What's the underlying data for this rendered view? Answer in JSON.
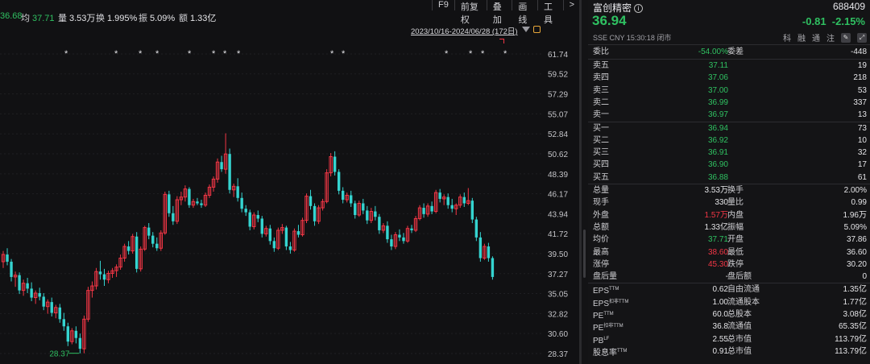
{
  "topbar": {
    "stats": [
      {
        "key": "",
        "value": "36.68",
        "color": "green"
      },
      {
        "key": "均",
        "value": "37.71",
        "color": "green"
      },
      {
        "key": "量",
        "value": "3.53万",
        "color": "white"
      },
      {
        "key": "换",
        "value": "1.995%",
        "color": "white"
      },
      {
        "key": "振",
        "value": "5.09%",
        "color": "white"
      },
      {
        "key": "额",
        "value": "1.33亿",
        "color": "white"
      }
    ],
    "toolbar": [
      "F9",
      "前复权",
      "叠加",
      "画线",
      "工具",
      ">"
    ],
    "range": "2023/10/16-2024/06/28 (172日)"
  },
  "chart_data": {
    "type": "candlestick",
    "y_ticks": [
      "61.74",
      "59.52",
      "57.29",
      "55.07",
      "52.84",
      "50.62",
      "48.39",
      "46.17",
      "43.94",
      "41.72",
      "39.50",
      "37.27",
      "35.05",
      "32.82",
      "30.60",
      "28.37"
    ],
    "ylim": [
      28.37,
      61.74
    ],
    "low_annotation": "28.37",
    "up_color": "#f23645",
    "down_color": "#35d4d0",
    "star_marker": "*",
    "star_groups": [
      1,
      1,
      1,
      2,
      1,
      2,
      1,
      2,
      1,
      1,
      1,
      2,
      1
    ],
    "candles": [
      [
        38.6,
        39.8,
        37.9,
        39.4
      ],
      [
        39.4,
        40.1,
        38.2,
        38.6
      ],
      [
        38.6,
        38.9,
        36.4,
        36.9
      ],
      [
        36.9,
        37.5,
        35.8,
        37.1
      ],
      [
        37.1,
        37.4,
        35.0,
        35.4
      ],
      [
        35.4,
        36.6,
        34.8,
        36.2
      ],
      [
        36.2,
        36.8,
        35.1,
        35.6
      ],
      [
        35.6,
        36.3,
        34.2,
        34.6
      ],
      [
        34.6,
        35.4,
        33.9,
        35.1
      ],
      [
        35.1,
        35.7,
        34.3,
        34.7
      ],
      [
        34.7,
        35.1,
        33.2,
        33.6
      ],
      [
        33.6,
        34.4,
        32.8,
        34.1
      ],
      [
        34.1,
        34.6,
        32.5,
        32.9
      ],
      [
        32.9,
        33.8,
        32.3,
        33.5
      ],
      [
        33.5,
        33.9,
        31.8,
        32.2
      ],
      [
        32.2,
        32.9,
        30.9,
        31.4
      ],
      [
        31.4,
        31.8,
        29.2,
        29.7
      ],
      [
        29.7,
        31.2,
        29.4,
        30.9
      ],
      [
        30.9,
        31.4,
        29.5,
        30.1
      ],
      [
        30.1,
        30.6,
        28.4,
        28.9
      ],
      [
        28.9,
        32.6,
        28.4,
        32.2
      ],
      [
        32.2,
        35.8,
        31.9,
        35.4
      ],
      [
        35.4,
        36.4,
        34.6,
        35.9
      ],
      [
        35.9,
        37.9,
        35.5,
        37.5
      ],
      [
        37.5,
        38.7,
        36.6,
        37.2
      ],
      [
        37.2,
        37.8,
        35.9,
        36.6
      ],
      [
        36.6,
        37.6,
        36.2,
        37.3
      ],
      [
        37.3,
        37.9,
        36.8,
        37.6
      ],
      [
        37.6,
        38.3,
        36.9,
        38.0
      ],
      [
        38.0,
        39.4,
        37.7,
        39.0
      ],
      [
        39.0,
        40.6,
        38.6,
        40.3
      ],
      [
        40.3,
        40.9,
        39.4,
        39.8
      ],
      [
        39.8,
        41.7,
        39.5,
        41.4
      ],
      [
        41.4,
        41.9,
        37.4,
        37.8
      ],
      [
        37.8,
        40.3,
        37.5,
        40.0
      ],
      [
        40.0,
        42.6,
        39.8,
        42.4
      ],
      [
        42.4,
        42.9,
        41.1,
        41.5
      ],
      [
        41.5,
        41.9,
        40.2,
        40.6
      ],
      [
        40.6,
        41.3,
        39.8,
        40.1
      ],
      [
        40.1,
        42.1,
        39.8,
        41.8
      ],
      [
        41.8,
        46.4,
        41.6,
        46.1
      ],
      [
        46.1,
        46.5,
        43.6,
        44.0
      ],
      [
        44.0,
        44.8,
        42.7,
        43.1
      ],
      [
        43.1,
        45.9,
        42.8,
        45.5
      ],
      [
        45.5,
        46.4,
        44.9,
        45.8
      ],
      [
        45.8,
        47.1,
        45.3,
        46.7
      ],
      [
        46.7,
        46.9,
        44.6,
        44.9
      ],
      [
        44.9,
        45.6,
        44.6,
        45.3
      ],
      [
        45.3,
        45.7,
        44.9,
        45.1
      ],
      [
        45.1,
        45.5,
        44.6,
        44.9
      ],
      [
        44.9,
        46.3,
        44.7,
        46.0
      ],
      [
        46.0,
        47.2,
        45.7,
        46.9
      ],
      [
        46.9,
        48.1,
        46.4,
        47.8
      ],
      [
        47.8,
        50.1,
        47.4,
        49.7
      ],
      [
        49.7,
        50.4,
        48.6,
        48.9
      ],
      [
        48.9,
        52.9,
        48.4,
        50.6
      ],
      [
        50.6,
        51.2,
        46.2,
        46.6
      ],
      [
        46.6,
        47.3,
        45.8,
        47.0
      ],
      [
        47.0,
        47.9,
        45.3,
        45.7
      ],
      [
        45.7,
        46.3,
        44.1,
        44.5
      ],
      [
        44.5,
        44.9,
        43.7,
        44.1
      ],
      [
        44.1,
        44.4,
        42.1,
        42.5
      ],
      [
        42.5,
        44.1,
        42.2,
        43.8
      ],
      [
        43.8,
        44.3,
        43.0,
        43.4
      ],
      [
        43.4,
        43.7,
        41.3,
        41.7
      ],
      [
        41.7,
        42.6,
        41.4,
        42.3
      ],
      [
        42.3,
        42.7,
        40.5,
        40.9
      ],
      [
        40.9,
        41.3,
        39.7,
        40.1
      ],
      [
        40.1,
        42.4,
        39.9,
        42.1
      ],
      [
        42.1,
        42.8,
        41.7,
        42.4
      ],
      [
        42.4,
        42.6,
        39.9,
        40.3
      ],
      [
        40.3,
        40.8,
        39.5,
        39.9
      ],
      [
        39.9,
        42.3,
        39.7,
        42.0
      ],
      [
        42.0,
        42.7,
        41.3,
        41.6
      ],
      [
        41.6,
        43.5,
        41.4,
        43.2
      ],
      [
        43.2,
        46.2,
        42.9,
        45.9
      ],
      [
        45.9,
        46.6,
        44.4,
        44.8
      ],
      [
        44.8,
        45.1,
        42.6,
        43.1
      ],
      [
        43.1,
        44.9,
        42.8,
        44.6
      ],
      [
        44.6,
        45.6,
        44.3,
        45.3
      ],
      [
        45.3,
        48.9,
        45.1,
        48.5
      ],
      [
        48.5,
        50.7,
        48.1,
        50.3
      ],
      [
        50.3,
        50.9,
        48.2,
        48.6
      ],
      [
        48.6,
        48.9,
        46.1,
        46.5
      ],
      [
        46.5,
        46.9,
        45.1,
        45.5
      ],
      [
        45.5,
        46.3,
        45.2,
        46.0
      ],
      [
        46.0,
        46.5,
        44.7,
        45.1
      ],
      [
        45.1,
        45.4,
        43.4,
        43.8
      ],
      [
        43.8,
        45.4,
        43.6,
        45.1
      ],
      [
        45.1,
        45.6,
        43.9,
        44.3
      ],
      [
        44.3,
        44.8,
        42.8,
        43.2
      ],
      [
        43.2,
        44.6,
        42.9,
        44.2
      ],
      [
        44.2,
        44.8,
        43.2,
        43.6
      ],
      [
        43.6,
        43.9,
        41.7,
        42.1
      ],
      [
        42.1,
        42.9,
        41.8,
        42.6
      ],
      [
        42.6,
        43.1,
        40.7,
        41.1
      ],
      [
        41.1,
        41.6,
        39.9,
        40.3
      ],
      [
        40.3,
        41.9,
        40.0,
        41.6
      ],
      [
        41.6,
        42.2,
        40.9,
        41.3
      ],
      [
        41.3,
        41.8,
        40.6,
        40.9
      ],
      [
        40.9,
        42.6,
        40.7,
        42.3
      ],
      [
        42.3,
        42.7,
        41.8,
        42.1
      ],
      [
        42.1,
        43.7,
        41.9,
        43.4
      ],
      [
        43.4,
        44.9,
        43.2,
        44.6
      ],
      [
        44.6,
        45.1,
        43.5,
        43.9
      ],
      [
        43.9,
        45.1,
        43.6,
        44.8
      ],
      [
        44.8,
        45.3,
        43.9,
        44.2
      ],
      [
        44.2,
        46.6,
        44.0,
        46.3
      ],
      [
        46.3,
        46.7,
        45.2,
        45.6
      ],
      [
        45.6,
        46.1,
        44.9,
        45.8
      ],
      [
        45.8,
        46.2,
        44.5,
        44.9
      ],
      [
        44.9,
        45.6,
        44.1,
        44.5
      ],
      [
        44.5,
        45.1,
        43.8,
        44.9
      ],
      [
        44.9,
        46.1,
        44.6,
        45.8
      ],
      [
        45.8,
        46.3,
        44.7,
        45.1
      ],
      [
        45.1,
        46.8,
        44.9,
        45.4
      ],
      [
        45.4,
        45.7,
        42.9,
        43.3
      ],
      [
        43.3,
        43.6,
        40.9,
        41.3
      ],
      [
        41.3,
        41.9,
        38.6,
        39.0
      ],
      [
        39.0,
        40.6,
        38.8,
        40.3
      ],
      [
        40.3,
        40.7,
        38.6,
        39.0
      ],
      [
        39.0,
        39.2,
        36.6,
        36.9
      ]
    ]
  },
  "quote": {
    "name": "富创精密",
    "info_icon": "i",
    "code": "688409",
    "price": "36.94",
    "change": "-0.81",
    "change_pct": "-2.15%",
    "meta": "SSE  CNY  15:30:18  闭市",
    "tags": [
      "科",
      "融",
      "通",
      "注"
    ],
    "tag_icons": [
      "✎",
      "⤢"
    ],
    "weibi": {
      "label": "委比",
      "value": "-54.00%",
      "label2": "委差",
      "value2": "-448"
    },
    "asks": [
      {
        "label": "卖五",
        "price": "37.11",
        "vol": "19"
      },
      {
        "label": "卖四",
        "price": "37.06",
        "vol": "218"
      },
      {
        "label": "卖三",
        "price": "37.00",
        "vol": "53"
      },
      {
        "label": "卖二",
        "price": "36.99",
        "vol": "337"
      },
      {
        "label": "卖一",
        "price": "36.97",
        "vol": "13"
      }
    ],
    "bids": [
      {
        "label": "买一",
        "price": "36.94",
        "vol": "73"
      },
      {
        "label": "买二",
        "price": "36.92",
        "vol": "10"
      },
      {
        "label": "买三",
        "price": "36.91",
        "vol": "32"
      },
      {
        "label": "买四",
        "price": "36.90",
        "vol": "17"
      },
      {
        "label": "买五",
        "price": "36.88",
        "vol": "61"
      }
    ],
    "stats": [
      {
        "l": "总量",
        "v": "3.53万",
        "c": "white",
        "l2": "换手",
        "v2": "2.00%",
        "c2": "white"
      },
      {
        "l": "现手",
        "v": "330",
        "c": "white",
        "l2": "量比",
        "v2": "0.99",
        "c2": "white"
      },
      {
        "l": "外盘",
        "v": "1.57万",
        "c": "red",
        "l2": "内盘",
        "v2": "1.96万",
        "c2": "green"
      },
      {
        "l": "总额",
        "v": "1.33亿",
        "c": "white",
        "l2": "振幅",
        "v2": "5.09%",
        "c2": "white"
      },
      {
        "l": "均价",
        "v": "37.71",
        "c": "green",
        "l2": "开盘",
        "v2": "37.86",
        "c2": "red"
      },
      {
        "l": "最高",
        "v": "38.60",
        "c": "red",
        "l2": "最低",
        "v2": "36.60",
        "c2": "green"
      },
      {
        "l": "涨停",
        "v": "45.30",
        "c": "red",
        "l2": "跌停",
        "v2": "30.20",
        "c2": "green"
      },
      {
        "l": "盘后量",
        "v": "-",
        "c": "white",
        "l2": "盘后额",
        "v2": "0",
        "c2": "white"
      }
    ],
    "fundamentals": [
      {
        "l": "EPS",
        "sup": "TTM",
        "v": "0.62",
        "l2": "自由流通",
        "v2": "1.35亿"
      },
      {
        "l": "EPS",
        "sup": "扣非TTM",
        "v": "1.00",
        "l2": "流通股本",
        "v2": "1.77亿"
      },
      {
        "l": "PE",
        "sup": "TTM",
        "v": "60.0",
        "l2": "总股本",
        "v2": "3.08亿"
      },
      {
        "l": "PE",
        "sup": "扣非TTM",
        "v": "36.8",
        "l2": "流通值",
        "v2": "65.35亿"
      },
      {
        "l": "PB",
        "sup": "LF",
        "v": "2.55",
        "l2": "总市值",
        "v2": "113.79亿"
      },
      {
        "l": "股息率",
        "sup": "TTM",
        "v": "0.91",
        "l2": "总市值",
        "v2": "113.79亿"
      }
    ]
  }
}
